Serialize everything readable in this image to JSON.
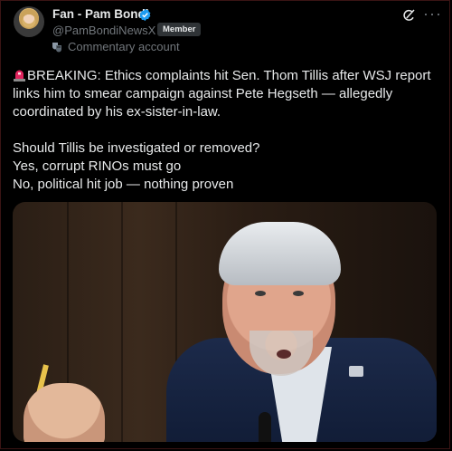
{
  "post": {
    "author_name": "Fan - Pam Bondi",
    "handle": "@PamBondiNewsX",
    "separator": "·",
    "member_badge": "Member",
    "commentary_label": "Commentary account",
    "body": {
      "headline": "BREAKING: Ethics complaints hit Sen. Thom Tillis after WSJ report links him to smear campaign against Pete Hegseth — allegedly coordinated by his ex-sister-in-law.",
      "question": "Should Tillis be investigated or removed?",
      "option_1": "Yes, corrupt RINOs must go",
      "option_2": "No, political hit job — nothing proven"
    },
    "icons": {
      "verified": "verified-badge-icon",
      "grok": "grok-icon",
      "more": "more-options-icon",
      "commentary": "theater-mask-icon",
      "siren": "siren-emoji-icon"
    },
    "colors": {
      "background": "#000000",
      "text_primary": "#e7e9ea",
      "text_secondary": "#71767b",
      "verified_blue": "#1d9bf0",
      "badge_bg": "#2f3336"
    }
  }
}
